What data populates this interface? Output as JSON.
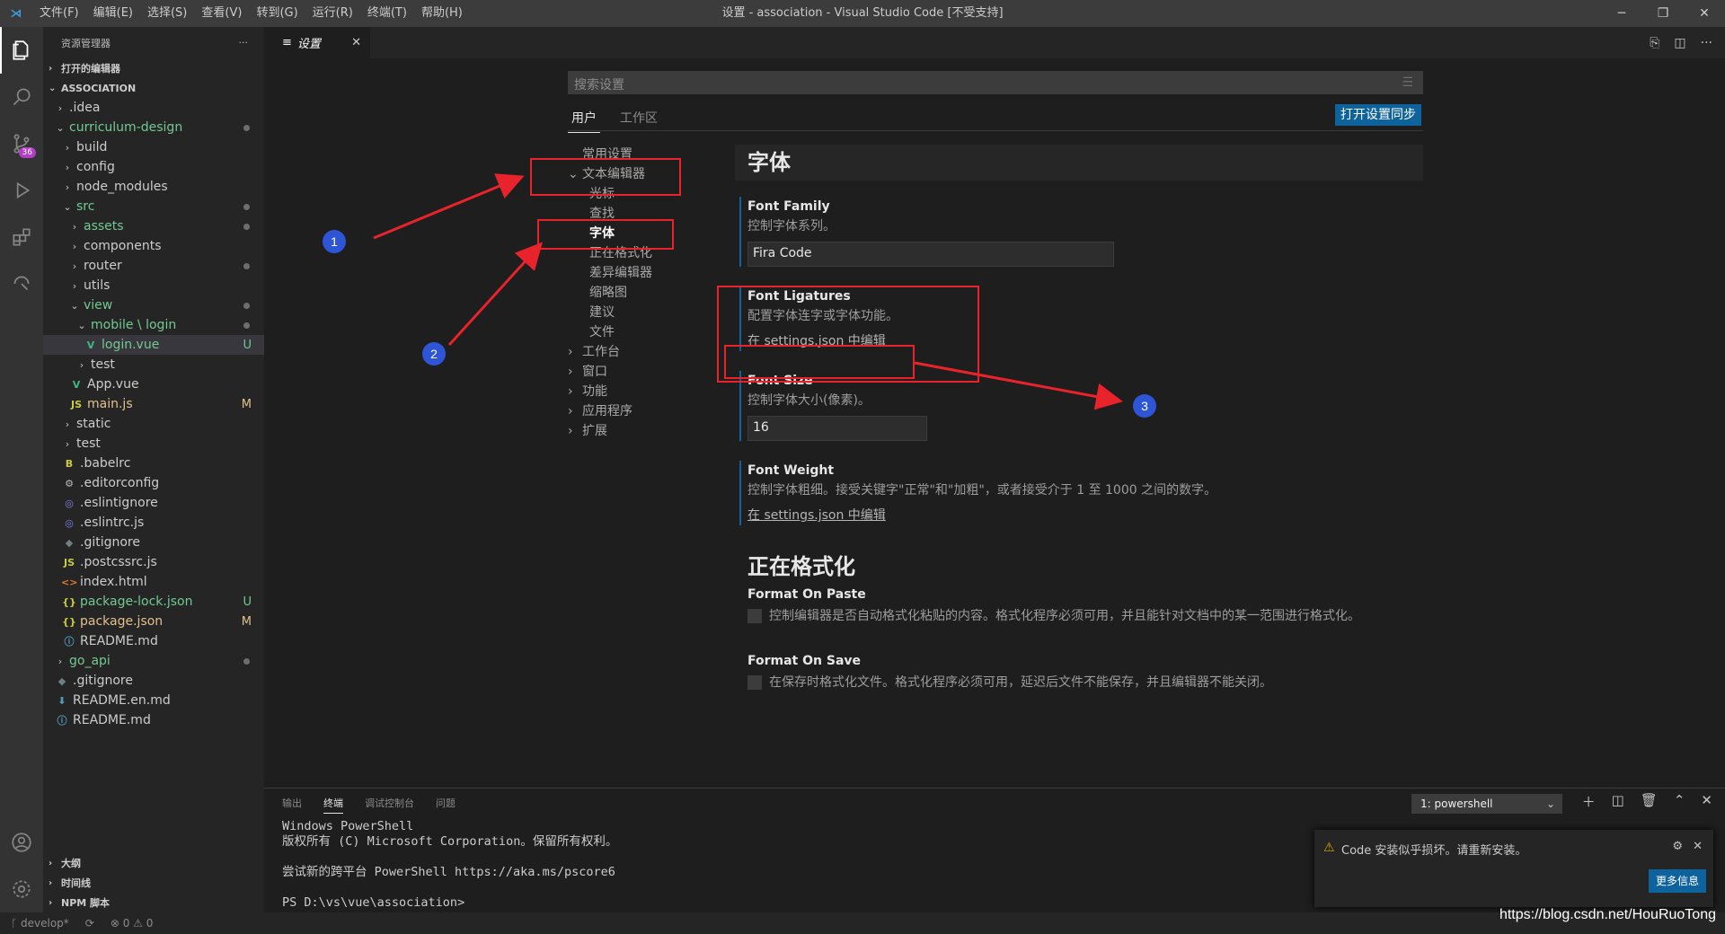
{
  "titlebar": {
    "title": "设置 - association - Visual Studio Code [不受支持]",
    "menu": [
      "文件(F)",
      "编辑(E)",
      "选择(S)",
      "查看(V)",
      "转到(G)",
      "运行(R)",
      "终端(T)",
      "帮助(H)"
    ]
  },
  "activity": {
    "scm_badge": "36"
  },
  "sidebar": {
    "title": "资源管理器",
    "more": "···",
    "open_editors": "打开的编辑器",
    "project": "ASSOCIATION",
    "items": [
      {
        "label": ".idea",
        "indent": 1,
        "type": "folder",
        "color": "#cccccc"
      },
      {
        "label": "curriculum-design",
        "indent": 1,
        "type": "folder-open",
        "color": "#73c991",
        "dot": true
      },
      {
        "label": "build",
        "indent": 2,
        "type": "folder",
        "color": "#cccccc"
      },
      {
        "label": "config",
        "indent": 2,
        "type": "folder",
        "color": "#cccccc"
      },
      {
        "label": "node_modules",
        "indent": 2,
        "type": "folder",
        "color": "#cccccc"
      },
      {
        "label": "src",
        "indent": 2,
        "type": "folder-open",
        "color": "#73c991",
        "dot": true
      },
      {
        "label": "assets",
        "indent": 3,
        "type": "folder",
        "color": "#73c991",
        "dot": true
      },
      {
        "label": "components",
        "indent": 3,
        "type": "folder",
        "color": "#cccccc"
      },
      {
        "label": "router",
        "indent": 3,
        "type": "folder",
        "color": "#cccccc",
        "dot": true
      },
      {
        "label": "utils",
        "indent": 3,
        "type": "folder",
        "color": "#cccccc"
      },
      {
        "label": "view",
        "indent": 3,
        "type": "folder-open",
        "color": "#73c991",
        "dot": true
      },
      {
        "label": "mobile \\ login",
        "indent": 4,
        "type": "folder-open",
        "color": "#73c991",
        "dot": true
      },
      {
        "label": "login.vue",
        "indent": 5,
        "type": "vue",
        "color": "#73c991",
        "deco": "U",
        "selected": true
      },
      {
        "label": "test",
        "indent": 4,
        "type": "folder",
        "color": "#cccccc"
      },
      {
        "label": "App.vue",
        "indent": 3,
        "type": "vue",
        "color": "#cccccc"
      },
      {
        "label": "main.js",
        "indent": 3,
        "type": "js",
        "color": "#e2c08d",
        "deco": "M"
      },
      {
        "label": "static",
        "indent": 2,
        "type": "folder",
        "color": "#cccccc"
      },
      {
        "label": "test",
        "indent": 2,
        "type": "folder",
        "color": "#cccccc"
      },
      {
        "label": ".babelrc",
        "indent": 2,
        "type": "babel",
        "color": "#cccccc"
      },
      {
        "label": ".editorconfig",
        "indent": 2,
        "type": "gear",
        "color": "#cccccc"
      },
      {
        "label": ".eslintignore",
        "indent": 2,
        "type": "eslint",
        "color": "#cccccc"
      },
      {
        "label": ".eslintrc.js",
        "indent": 2,
        "type": "eslint",
        "color": "#cccccc"
      },
      {
        "label": ".gitignore",
        "indent": 2,
        "type": "git",
        "color": "#cccccc"
      },
      {
        "label": ".postcssrc.js",
        "indent": 2,
        "type": "js",
        "color": "#cccccc"
      },
      {
        "label": "index.html",
        "indent": 2,
        "type": "html",
        "color": "#cccccc"
      },
      {
        "label": "package-lock.json",
        "indent": 2,
        "type": "json",
        "color": "#73c991",
        "deco": "U"
      },
      {
        "label": "package.json",
        "indent": 2,
        "type": "json",
        "color": "#e2c08d",
        "deco": "M"
      },
      {
        "label": "README.md",
        "indent": 2,
        "type": "info",
        "color": "#cccccc"
      },
      {
        "label": "go_api",
        "indent": 1,
        "type": "folder",
        "color": "#73c991",
        "dot": true
      },
      {
        "label": ".gitignore",
        "indent": 1,
        "type": "git",
        "color": "#cccccc"
      },
      {
        "label": "README.en.md",
        "indent": 1,
        "type": "md",
        "color": "#cccccc"
      },
      {
        "label": "README.md",
        "indent": 1,
        "type": "info",
        "color": "#cccccc"
      }
    ],
    "bottom_sections": [
      "大纲",
      "时间线",
      "NPM 脚本"
    ]
  },
  "editor": {
    "tab_label": "设置",
    "tab_close": "✕"
  },
  "settings": {
    "search_placeholder": "搜索设置",
    "scope_user": "用户",
    "scope_workspace": "工作区",
    "sync_button": "打开设置同步",
    "toc": [
      {
        "label": "常用设置",
        "level": 0,
        "chev": ""
      },
      {
        "label": "文本编辑器",
        "level": 0,
        "chev": "⌄"
      },
      {
        "label": "光标",
        "level": 1,
        "chev": ""
      },
      {
        "label": "查找",
        "level": 1,
        "chev": ""
      },
      {
        "label": "字体",
        "level": 1,
        "chev": "",
        "bold": true
      },
      {
        "label": "正在格式化",
        "level": 1,
        "chev": ""
      },
      {
        "label": "差异编辑器",
        "level": 1,
        "chev": ""
      },
      {
        "label": "缩略图",
        "level": 1,
        "chev": ""
      },
      {
        "label": "建议",
        "level": 1,
        "chev": ""
      },
      {
        "label": "文件",
        "level": 1,
        "chev": ""
      },
      {
        "label": "工作台",
        "level": 0,
        "chev": "›"
      },
      {
        "label": "窗口",
        "level": 0,
        "chev": "›"
      },
      {
        "label": "功能",
        "level": 0,
        "chev": "›"
      },
      {
        "label": "应用程序",
        "level": 0,
        "chev": "›"
      },
      {
        "label": "扩展",
        "level": 0,
        "chev": "›"
      }
    ],
    "section_font": "字体",
    "font_family": {
      "title": "Font Family",
      "desc": "控制字体系列。",
      "value": "Fira Code"
    },
    "font_ligatures": {
      "title": "Font Ligatures",
      "desc": "配置字体连字或字体功能。",
      "link": "在 settings.json 中编辑"
    },
    "font_size": {
      "title": "Font Size",
      "desc": "控制字体大小(像素)。",
      "value": "16"
    },
    "font_weight": {
      "title": "Font Weight",
      "desc": "控制字体粗细。接受关键字\"正常\"和\"加粗\"，或者接受介于 1 至 1000 之间的数字。",
      "link": "在 settings.json 中编辑"
    },
    "section_format": "正在格式化",
    "format_on_paste": {
      "title": "Format On Paste",
      "desc": "控制编辑器是否自动格式化粘贴的内容。格式化程序必须可用，并且能针对文档中的某一范围进行格式化。"
    },
    "format_on_save": {
      "title": "Format On Save",
      "desc": "在保存时格式化文件。格式化程序必须可用，延迟后文件不能保存，并且编辑器不能关闭。"
    }
  },
  "panel": {
    "tabs": [
      "输出",
      "终端",
      "调试控制台",
      "问题"
    ],
    "active_tab": "终端",
    "terminal_select": "1: powershell",
    "terminal_lines": "Windows PowerShell\n版权所有 (C) Microsoft Corporation。保留所有权利。\n\n尝试新的跨平台 PowerShell https://aka.ms/pscore6\n\nPS D:\\vs\\vue\\association>"
  },
  "notification": {
    "message": "Code 安装似乎损坏。请重新安装。",
    "button": "更多信息"
  },
  "statusbar": {
    "branch": "develop*",
    "sync": "⟳",
    "problems": "⊗ 0 ⚠ 0"
  },
  "watermark": "https://blog.csdn.net/HouRuoTong",
  "annotations": [
    "1",
    "2",
    "3"
  ],
  "colors": {
    "accent": "#0e639c",
    "annotation_red": "#e8232b",
    "annotation_blue": "#2d55d6"
  }
}
